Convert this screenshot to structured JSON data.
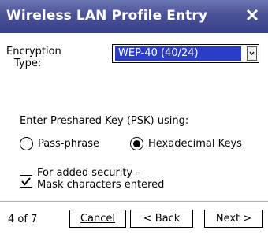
{
  "window": {
    "title": "Wireless LAN Profile Entry",
    "close_icon": "close-icon"
  },
  "encryption": {
    "label_line1": "Encryption",
    "label_line2": "Type:",
    "selected_value": "WEP-40 (40/24)",
    "dropdown_icon": "chevron-down-icon"
  },
  "psk": {
    "prompt": "Enter Preshared Key (PSK) using:",
    "options": [
      {
        "label": "Pass-phrase",
        "selected": false
      },
      {
        "label": "Hexadecimal Keys",
        "selected": true
      }
    ]
  },
  "mask_option": {
    "line1": "For added security -",
    "line2": "Mask characters entered",
    "checked": true
  },
  "footer": {
    "page_indicator": "4 of 7",
    "cancel_label": "Cancel",
    "back_label": "< Back",
    "next_label": "Next >"
  },
  "colors": {
    "titlebar": "#4a5196",
    "selection": "#2b3cc6"
  }
}
